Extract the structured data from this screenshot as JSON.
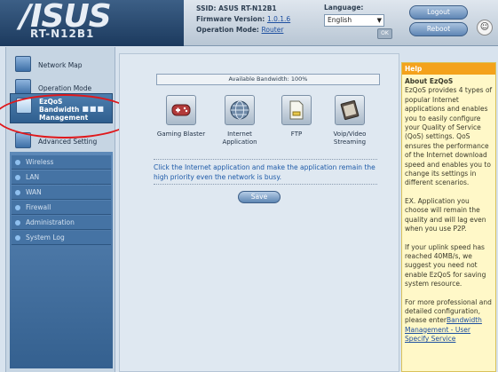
{
  "header": {
    "brand": "/ISUS",
    "model": "RT-N12B1",
    "ssid_label": "SSID:",
    "ssid_value": "ASUS RT-N12B1",
    "firmware_label": "Firmware Version:",
    "firmware_value": "1.0.1.6",
    "opmode_label": "Operation Mode:",
    "opmode_value": "Router",
    "language_label": "Language:",
    "language_value": "English",
    "ok_label": "OK",
    "logout_label": "Logout",
    "reboot_label": "Reboot"
  },
  "sidebar": {
    "network_map": "Network Map",
    "operation_mode": "Operation Mode",
    "ezqos": [
      "EzQoS",
      "Bandwidth",
      "Management"
    ],
    "advanced": "Advanced Setting",
    "sub_items": [
      "Wireless",
      "LAN",
      "WAN",
      "Firewall",
      "Administration",
      "System Log"
    ]
  },
  "main": {
    "bandwidth": "Available Bandwidth: 100%",
    "apps": [
      {
        "label": "Gaming Blaster",
        "icon": "gamepad-icon"
      },
      {
        "label": "Internet Application",
        "icon": "globe-icon"
      },
      {
        "label": "FTP",
        "icon": "ftp-icon"
      },
      {
        "label": "Voip/Video Streaming",
        "icon": "video-icon"
      }
    ],
    "instruction": "Click the Internet application and make the application remain the high priority even the network is busy.",
    "save_label": "Save"
  },
  "help": {
    "title": "Help",
    "heading": "About EzQoS",
    "p1": "EzQoS provides 4 types of popular Internet applications and enables you to easily configure your Quality of Service (QoS) settings. QoS ensures the performance of the Internet download speed and enables you to change its settings in different scenarios.",
    "p2": "EX. Application you choose will remain the quality and will lag even when you use P2P.",
    "p3": "If your uplink speed has reached 40MB/s, we suggest you need not enable EzQoS for saving system resource.",
    "p4": "For more professional and detailed configuration, please enter",
    "link": "Bandwidth Management - User Specify Service"
  },
  "colors": {
    "accent": "#f4a21c",
    "annotation": "#e0181b",
    "instruction_text": "#1d5aa8"
  }
}
